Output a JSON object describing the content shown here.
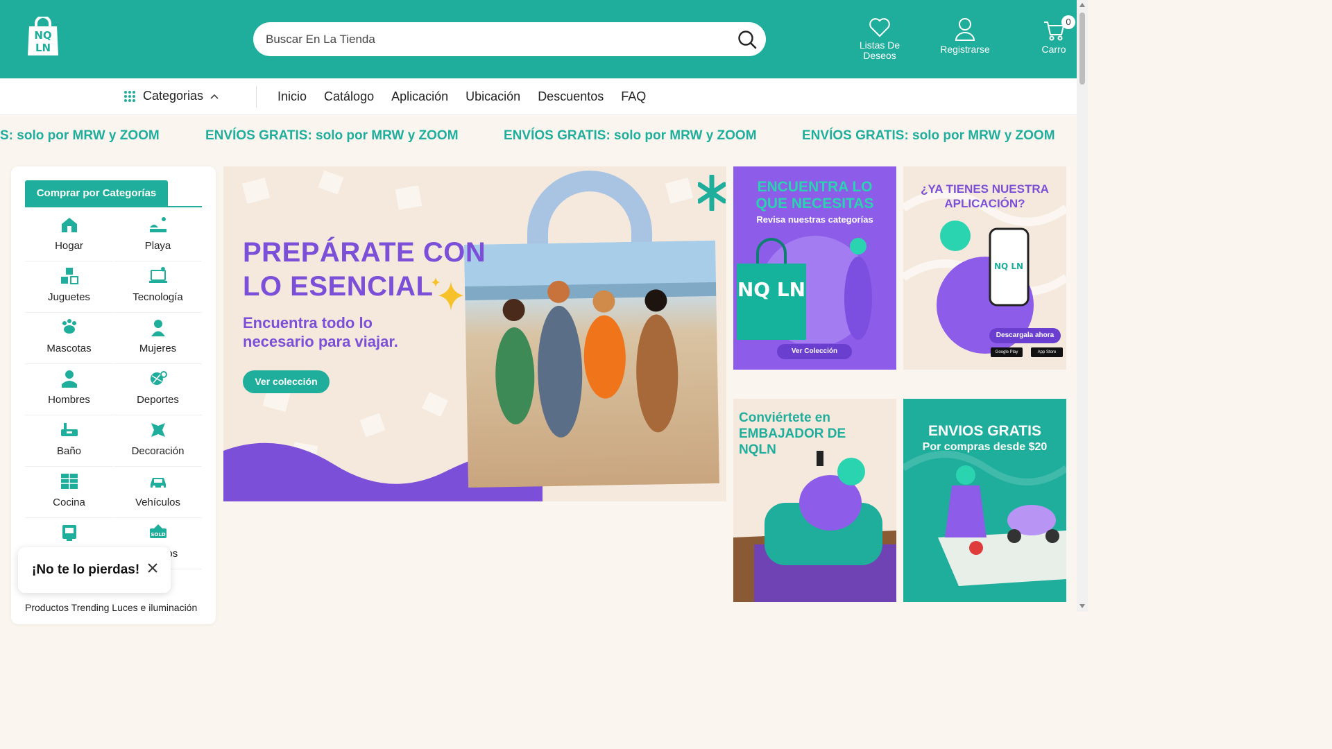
{
  "header": {
    "logo_text": "NQ LN",
    "search_placeholder": "Buscar En La Tienda",
    "wishlist_label": "Listas De Deseos",
    "register_label": "Registrarse",
    "cart_label": "Carro",
    "cart_count": "0"
  },
  "nav": {
    "categories_label": "Categorias",
    "links": [
      "Inicio",
      "Catálogo",
      "Aplicación",
      "Ubicación",
      "Descuentos",
      "FAQ"
    ]
  },
  "marquee": {
    "items": [
      "S: solo por MRW y ZOOM",
      "ENVÍOS GRATIS: solo por MRW y ZOOM",
      "ENVÍOS GRATIS: solo por MRW y ZOOM",
      "ENVÍOS GRATIS: solo por MRW y ZOOM"
    ]
  },
  "sidebar": {
    "tab_label": "Comprar por Categorías",
    "categories": [
      {
        "label": "Hogar",
        "icon": "home-icon"
      },
      {
        "label": "Playa",
        "icon": "beach-icon"
      },
      {
        "label": "Juguetes",
        "icon": "toys-icon"
      },
      {
        "label": "Tecnología",
        "icon": "laptop-icon"
      },
      {
        "label": "Mascotas",
        "icon": "pet-icon"
      },
      {
        "label": "Mujeres",
        "icon": "woman-icon"
      },
      {
        "label": "Hombres",
        "icon": "man-icon"
      },
      {
        "label": "Deportes",
        "icon": "sports-icon"
      },
      {
        "label": "Baño",
        "icon": "bath-icon"
      },
      {
        "label": "Decoración",
        "icon": "decoration-icon"
      },
      {
        "label": "Cocina",
        "icon": "kitchen-icon"
      },
      {
        "label": "Vehículos",
        "icon": "car-icon"
      },
      {
        "label": "",
        "icon": "offers-icon"
      },
      {
        "label": "idos",
        "icon": "sold-icon"
      }
    ],
    "trending_text": "Productos Trending Luces e iluminación"
  },
  "toast": {
    "text": "¡No te lo pierdas!"
  },
  "hero": {
    "title_line1": "PREPÁRATE CON",
    "title_line2": "LO ESENCIAL",
    "subtitle_line1": "Encuentra todo lo",
    "subtitle_line2": "necesario para viajar.",
    "button_label": "Ver colección"
  },
  "cards": {
    "card1": {
      "title_line1": "ENCUENTRA LO",
      "title_line2": "QUE NECESITAS",
      "subtitle": "Revisa nuestras categorías",
      "button_label": "Ver Colección",
      "bag_text": "NQ LN"
    },
    "card2": {
      "title_line1": "¿YA TIENES NUESTRA",
      "title_line2": "APLICACIÓN?",
      "button_label": "Descargala ahora",
      "phone_text": "NQ LN",
      "store1": "Google Play",
      "store2": "App Store"
    },
    "card3": {
      "title_line1": "Conviértete en",
      "title_line2": "EMBAJADOR DE",
      "title_line3": "NQLN"
    },
    "card4": {
      "title": "ENVIOS GRATIS",
      "subtitle": "Por compras desde $20"
    }
  },
  "colors": {
    "brand": "#1fae9c",
    "accent": "#7b4fd8",
    "background": "#faf6ef"
  }
}
